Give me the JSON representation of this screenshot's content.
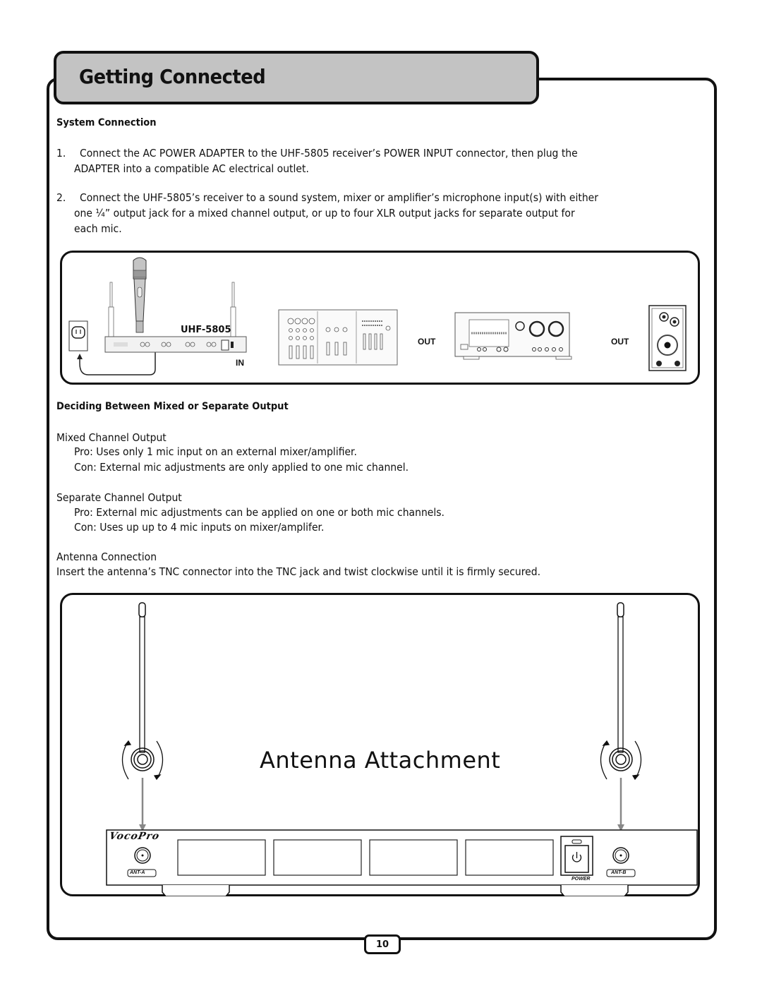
{
  "header": {
    "title": "Getting Connected"
  },
  "system_connection": {
    "heading": "System Connection",
    "steps": [
      {
        "number": "1.",
        "lines": [
          "Connect the AC POWER ADAPTER to the UHF-5805 receiver’s POWER INPUT connector, then plug the",
          "ADAPTER into a compatible AC electrical outlet."
        ]
      },
      {
        "number": "2.",
        "lines": [
          "Connect the UHF-5805’s receiver to a sound system, mixer or amplifier’s microphone input(s) with either",
          "one ¼” output jack for a mixed channel output, or up to four XLR output jacks for separate output for",
          "each mic."
        ]
      }
    ]
  },
  "connection_diagram": {
    "device_label": "UHF-5805",
    "in_label": "IN",
    "out_label_1": "OUT",
    "out_label_2": "OUT"
  },
  "deciding": {
    "heading": "Deciding Between Mixed or Separate Output",
    "mixed": {
      "title": "Mixed Channel Output",
      "pro": "Pro: Uses only 1 mic input on an external mixer/amplifier.",
      "con": "Con: External mic adjustments are only applied to one mic channel."
    },
    "separate": {
      "title": "Separate Channel Output",
      "pro": "Pro: External mic adjustments can be applied on one or both mic channels.",
      "con": "Con: Uses up up to 4 mic inputs on mixer/amplifer."
    }
  },
  "antenna": {
    "title": "Antenna Connection",
    "text": "Insert the antenna’s TNC connector into the TNC jack and twist clockwise until it is firmly secured."
  },
  "antenna_diagram": {
    "title": "Antenna Attachment",
    "brand": "VocoPro",
    "ant_a": "ANT-A",
    "ant_b": "ANT-B",
    "power": "POWER"
  },
  "footer": {
    "page_number": "10"
  }
}
